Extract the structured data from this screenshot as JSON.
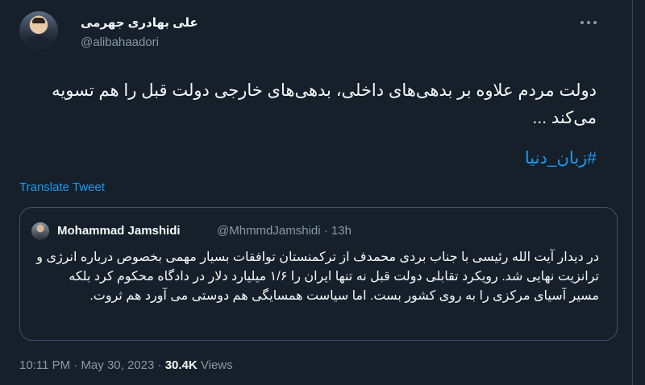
{
  "author": {
    "name": "علی بهادری جهرمی",
    "handle": "@alibahaadori"
  },
  "tweet": {
    "text": "دولت مردم علاوه بر بدهی‌های داخلی، بدهی‌های خارجی دولت قبل را هم تسویه می‌کند ...",
    "hashtag": "#زبان_دنیا",
    "translate_label": "Translate Tweet"
  },
  "quoted": {
    "name": "Mohammad Jamshidi",
    "handle": "@MhmmdJamshidi · 13h",
    "text": "در دیدار آیت الله رئیسی با جناب بردی محمدف از ترکمنستان توافقات بسیار مهمی بخصوص درباره انرژی و ترانزیت نهایی شد. رویکرد تقابلی دولت قبل نه تنها ایران را ۱/۶ میلیارد دلار در دادگاه محکوم کرد بلکه مسیر آسیای مرکزی را به روی کشور بست. اما سیاست همسایگی هم دوستی می آورد هم ثروت."
  },
  "meta": {
    "time": "10:11 PM",
    "sep1": " · ",
    "date": "May 30, 2023",
    "sep2": " · ",
    "views_count": "30.4K",
    "views_label": " Views"
  },
  "icons": {
    "more": "more-horizontal-icon"
  },
  "colors": {
    "background": "#15202b",
    "link": "#1d9bf0",
    "secondary_text": "#8b98a5",
    "border": "#425364"
  }
}
